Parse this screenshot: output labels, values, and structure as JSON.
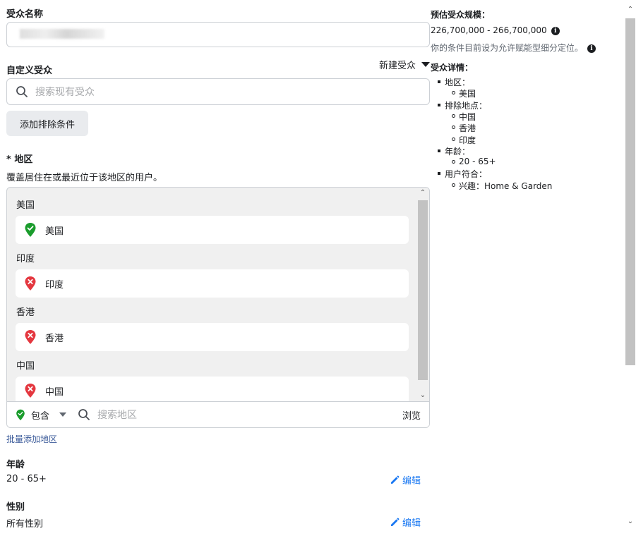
{
  "audience_name": {
    "label": "受众名称"
  },
  "custom_audience": {
    "label": "自定义受众",
    "new_audience": "新建受众",
    "search_placeholder": "搜索现有受众",
    "add_exclusion": "添加排除条件"
  },
  "location": {
    "label": "* 地区",
    "description": "覆盖居住在或最近位于该地区的用户。",
    "groups": [
      {
        "title": "美国",
        "item": "美国",
        "status": "included"
      },
      {
        "title": "印度",
        "item": "印度",
        "status": "excluded"
      },
      {
        "title": "香港",
        "item": "香港",
        "status": "excluded"
      },
      {
        "title": "中国",
        "item": "中国",
        "status": "excluded"
      }
    ],
    "include_label": "包含",
    "search_placeholder": "搜索地区",
    "browse": "浏览",
    "bulk_add": "批量添加地区"
  },
  "age": {
    "label": "年龄",
    "value": "20 - 65+",
    "edit": "编辑"
  },
  "gender": {
    "label": "性别",
    "value": "所有性别",
    "edit": "编辑"
  },
  "estimate": {
    "title": "预估受众规模：",
    "range": "226,700,000 - 266,700,000",
    "note": "你的条件目前设为允许赋能型细分定位。"
  },
  "details": {
    "title": "受众详情：",
    "region": "地区：",
    "region_items": [
      "美国"
    ],
    "excluded": "排除地点：",
    "excluded_items": [
      "中国",
      "香港",
      "印度"
    ],
    "age": "年龄：",
    "age_items": [
      "20 - 65+"
    ],
    "match": "用户符合：",
    "match_items": [
      "兴趣：Home & Garden"
    ]
  },
  "colors": {
    "included": "#1a9c2c",
    "excluded": "#e4373f",
    "link": "#385898",
    "edit": "#1877f2"
  }
}
